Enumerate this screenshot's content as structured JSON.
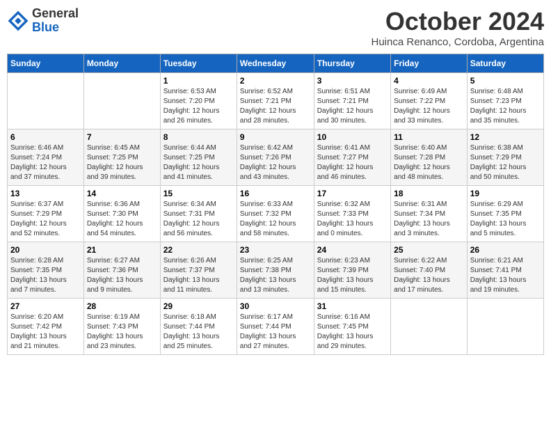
{
  "header": {
    "logo_line1": "General",
    "logo_line2": "Blue",
    "month": "October 2024",
    "location": "Huinca Renanco, Cordoba, Argentina"
  },
  "weekdays": [
    "Sunday",
    "Monday",
    "Tuesday",
    "Wednesday",
    "Thursday",
    "Friday",
    "Saturday"
  ],
  "weeks": [
    [
      {
        "day": "",
        "info": ""
      },
      {
        "day": "",
        "info": ""
      },
      {
        "day": "1",
        "info": "Sunrise: 6:53 AM\nSunset: 7:20 PM\nDaylight: 12 hours\nand 26 minutes."
      },
      {
        "day": "2",
        "info": "Sunrise: 6:52 AM\nSunset: 7:21 PM\nDaylight: 12 hours\nand 28 minutes."
      },
      {
        "day": "3",
        "info": "Sunrise: 6:51 AM\nSunset: 7:21 PM\nDaylight: 12 hours\nand 30 minutes."
      },
      {
        "day": "4",
        "info": "Sunrise: 6:49 AM\nSunset: 7:22 PM\nDaylight: 12 hours\nand 33 minutes."
      },
      {
        "day": "5",
        "info": "Sunrise: 6:48 AM\nSunset: 7:23 PM\nDaylight: 12 hours\nand 35 minutes."
      }
    ],
    [
      {
        "day": "6",
        "info": "Sunrise: 6:46 AM\nSunset: 7:24 PM\nDaylight: 12 hours\nand 37 minutes."
      },
      {
        "day": "7",
        "info": "Sunrise: 6:45 AM\nSunset: 7:25 PM\nDaylight: 12 hours\nand 39 minutes."
      },
      {
        "day": "8",
        "info": "Sunrise: 6:44 AM\nSunset: 7:25 PM\nDaylight: 12 hours\nand 41 minutes."
      },
      {
        "day": "9",
        "info": "Sunrise: 6:42 AM\nSunset: 7:26 PM\nDaylight: 12 hours\nand 43 minutes."
      },
      {
        "day": "10",
        "info": "Sunrise: 6:41 AM\nSunset: 7:27 PM\nDaylight: 12 hours\nand 46 minutes."
      },
      {
        "day": "11",
        "info": "Sunrise: 6:40 AM\nSunset: 7:28 PM\nDaylight: 12 hours\nand 48 minutes."
      },
      {
        "day": "12",
        "info": "Sunrise: 6:38 AM\nSunset: 7:29 PM\nDaylight: 12 hours\nand 50 minutes."
      }
    ],
    [
      {
        "day": "13",
        "info": "Sunrise: 6:37 AM\nSunset: 7:29 PM\nDaylight: 12 hours\nand 52 minutes."
      },
      {
        "day": "14",
        "info": "Sunrise: 6:36 AM\nSunset: 7:30 PM\nDaylight: 12 hours\nand 54 minutes."
      },
      {
        "day": "15",
        "info": "Sunrise: 6:34 AM\nSunset: 7:31 PM\nDaylight: 12 hours\nand 56 minutes."
      },
      {
        "day": "16",
        "info": "Sunrise: 6:33 AM\nSunset: 7:32 PM\nDaylight: 12 hours\nand 58 minutes."
      },
      {
        "day": "17",
        "info": "Sunrise: 6:32 AM\nSunset: 7:33 PM\nDaylight: 13 hours\nand 0 minutes."
      },
      {
        "day": "18",
        "info": "Sunrise: 6:31 AM\nSunset: 7:34 PM\nDaylight: 13 hours\nand 3 minutes."
      },
      {
        "day": "19",
        "info": "Sunrise: 6:29 AM\nSunset: 7:35 PM\nDaylight: 13 hours\nand 5 minutes."
      }
    ],
    [
      {
        "day": "20",
        "info": "Sunrise: 6:28 AM\nSunset: 7:35 PM\nDaylight: 13 hours\nand 7 minutes."
      },
      {
        "day": "21",
        "info": "Sunrise: 6:27 AM\nSunset: 7:36 PM\nDaylight: 13 hours\nand 9 minutes."
      },
      {
        "day": "22",
        "info": "Sunrise: 6:26 AM\nSunset: 7:37 PM\nDaylight: 13 hours\nand 11 minutes."
      },
      {
        "day": "23",
        "info": "Sunrise: 6:25 AM\nSunset: 7:38 PM\nDaylight: 13 hours\nand 13 minutes."
      },
      {
        "day": "24",
        "info": "Sunrise: 6:23 AM\nSunset: 7:39 PM\nDaylight: 13 hours\nand 15 minutes."
      },
      {
        "day": "25",
        "info": "Sunrise: 6:22 AM\nSunset: 7:40 PM\nDaylight: 13 hours\nand 17 minutes."
      },
      {
        "day": "26",
        "info": "Sunrise: 6:21 AM\nSunset: 7:41 PM\nDaylight: 13 hours\nand 19 minutes."
      }
    ],
    [
      {
        "day": "27",
        "info": "Sunrise: 6:20 AM\nSunset: 7:42 PM\nDaylight: 13 hours\nand 21 minutes."
      },
      {
        "day": "28",
        "info": "Sunrise: 6:19 AM\nSunset: 7:43 PM\nDaylight: 13 hours\nand 23 minutes."
      },
      {
        "day": "29",
        "info": "Sunrise: 6:18 AM\nSunset: 7:44 PM\nDaylight: 13 hours\nand 25 minutes."
      },
      {
        "day": "30",
        "info": "Sunrise: 6:17 AM\nSunset: 7:44 PM\nDaylight: 13 hours\nand 27 minutes."
      },
      {
        "day": "31",
        "info": "Sunrise: 6:16 AM\nSunset: 7:45 PM\nDaylight: 13 hours\nand 29 minutes."
      },
      {
        "day": "",
        "info": ""
      },
      {
        "day": "",
        "info": ""
      }
    ]
  ]
}
